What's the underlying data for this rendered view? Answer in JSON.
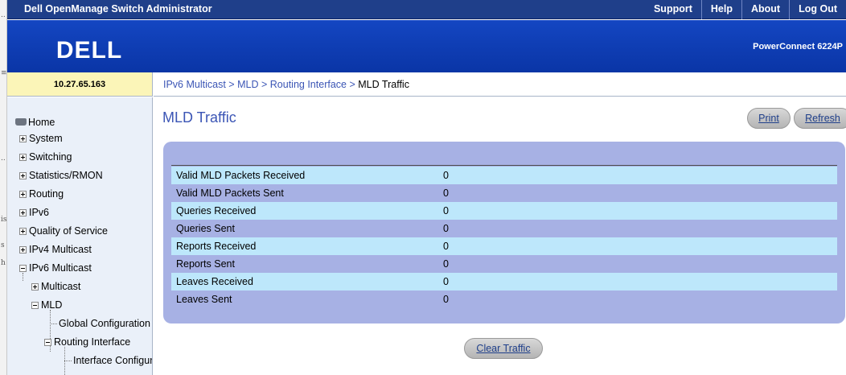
{
  "app": {
    "title": "Dell OpenManage Switch Administrator",
    "nav": [
      "Support",
      "Help",
      "About",
      "Log Out"
    ],
    "logo_text": "DELL",
    "product": "PowerConnect 6224P",
    "ip_address": "10.27.65.163"
  },
  "breadcrumb": {
    "items": [
      "IPv6 Multicast",
      "MLD",
      "Routing Interface"
    ],
    "separator": ">",
    "current": "MLD Traffic"
  },
  "sidebar": {
    "home": "Home",
    "items": [
      "System",
      "Switching",
      "Statistics/RMON",
      "Routing",
      "IPv6",
      "Quality of Service",
      "IPv4 Multicast",
      "IPv6 Multicast"
    ],
    "ipv6_children": [
      "Multicast",
      "MLD"
    ],
    "mld_children": [
      "Global Configuration",
      "Routing Interface"
    ],
    "routing_interface_children": [
      "Interface Configuration"
    ]
  },
  "page": {
    "title": "MLD Traffic",
    "print_label": "Print",
    "refresh_label": "Refresh",
    "clear_label": "Clear Traffic"
  },
  "stats": [
    {
      "label": "Valid MLD Packets Received",
      "value": "0"
    },
    {
      "label": "Valid MLD Packets Sent",
      "value": "0"
    },
    {
      "label": "Queries Received",
      "value": "0"
    },
    {
      "label": "Queries Sent",
      "value": "0"
    },
    {
      "label": "Reports Received",
      "value": "0"
    },
    {
      "label": "Reports Sent",
      "value": "0"
    },
    {
      "label": "Leaves Received",
      "value": "0"
    },
    {
      "label": "Leaves Sent",
      "value": "0"
    }
  ],
  "colors": {
    "topbar": "#1f3f8a",
    "banner": "#0b3bb0",
    "panel": "#a7b1e4",
    "row_light": "#bde7fb",
    "sidebar": "#eaf0f9",
    "ip_box": "#fbf5b8",
    "title_blue": "#3b55b5"
  }
}
